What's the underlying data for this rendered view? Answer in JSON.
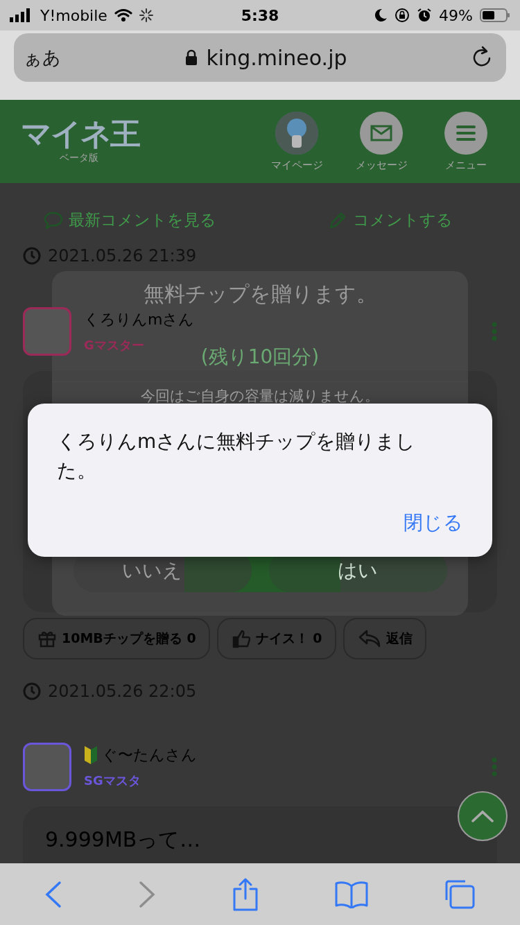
{
  "status_bar": {
    "carrier": "Y!mobile",
    "time": "5:38",
    "battery": "49%"
  },
  "address_bar": {
    "text_size": "ぁあ",
    "url": "king.mineo.jp"
  },
  "header": {
    "logo": "マイネ王",
    "logo_sub": "ベータ版",
    "nav": [
      {
        "label": "マイページ",
        "kind": "avatar"
      },
      {
        "label": "メッセージ",
        "kind": "mail"
      },
      {
        "label": "メニュー",
        "kind": "menu"
      }
    ]
  },
  "links": [
    {
      "label": "最新コメントを見る",
      "kind": "comment"
    },
    {
      "label": "コメントする",
      "kind": "pencil"
    }
  ],
  "comments": [
    {
      "time": "2021.05.26 21:39",
      "user": "くろりんmさん",
      "beginner": false,
      "rank": "Gマスター",
      "color": "#9c2a58",
      "actions": [
        {
          "kind": "gift",
          "label": "10MBチップを贈る",
          "count": "0"
        },
        {
          "kind": "like",
          "label": "ナイス！",
          "count": "0"
        },
        {
          "kind": "reply",
          "label": "返信"
        }
      ]
    },
    {
      "time": "2021.05.26 22:05",
      "user": "ぐ〜たんさん",
      "beginner": true,
      "rank": "SGマスタ",
      "color": "#6a56d8",
      "body": "9.999MBって…"
    }
  ],
  "tip_dialog": {
    "title": "無料チップを贈ります。",
    "remaining": "(残り10回分)",
    "note": "今回はご自身の容量は減りません。",
    "buttons": [
      {
        "label": "いいえ",
        "kind": "secondary"
      },
      {
        "label": "はい",
        "kind": "primary"
      }
    ]
  },
  "alert": {
    "message": "くろりんmさんに無料チップを贈りました。",
    "button": "閉じる"
  },
  "toolbar": [
    {
      "kind": "back",
      "disabled": false
    },
    {
      "kind": "forward",
      "disabled": true
    },
    {
      "kind": "share",
      "disabled": false
    },
    {
      "kind": "bookmarks",
      "disabled": false
    },
    {
      "kind": "tabs",
      "disabled": false
    }
  ]
}
